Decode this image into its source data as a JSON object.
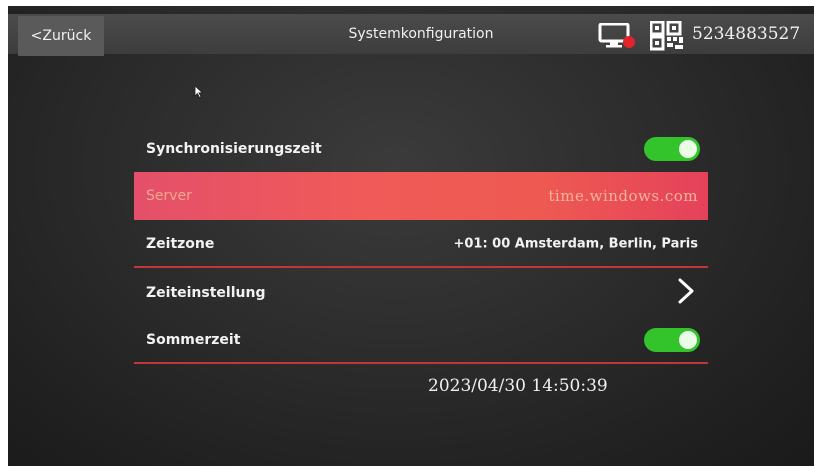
{
  "header": {
    "back_label": "<Zurück",
    "title": "Systemkonfiguration",
    "device_id": "5234883527",
    "monitor_icon": "monitor-record-icon",
    "qr_icon": "qr-code-icon"
  },
  "settings": {
    "sync_time": {
      "label": "Synchronisierungszeit",
      "enabled": true
    },
    "server": {
      "label": "Server",
      "value": "time.windows.com"
    },
    "timezone": {
      "label": "Zeitzone",
      "value": "+01:  00 Amsterdam, Berlin, Paris"
    },
    "time_setting": {
      "label": "Zeiteinstellung",
      "icon": "chevron-right-icon"
    },
    "dst": {
      "label": "Sommerzeit",
      "enabled": true
    }
  },
  "datetime": "2023/04/30 14:50:39",
  "colors": {
    "accent_line": "#c0363a",
    "selected_row": "#f05a58",
    "toggle_on": "#33c42c"
  }
}
